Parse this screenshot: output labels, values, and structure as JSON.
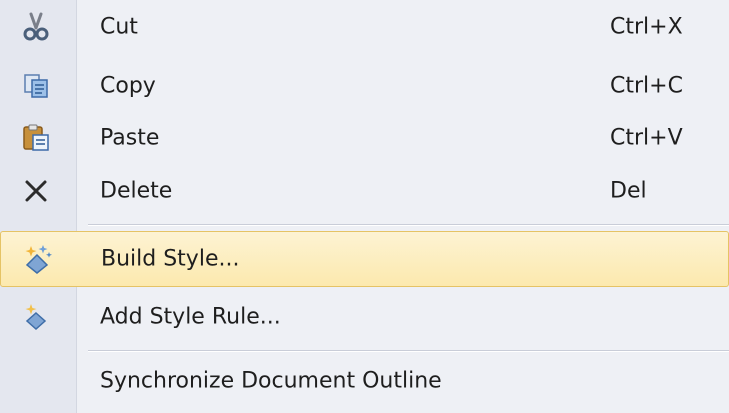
{
  "menu": {
    "items": [
      {
        "label": "Cut",
        "shortcut": "Ctrl+X",
        "icon": "scissors-icon"
      },
      {
        "label": "Copy",
        "shortcut": "Ctrl+C",
        "icon": "copy-icon"
      },
      {
        "label": "Paste",
        "shortcut": "Ctrl+V",
        "icon": "paste-icon"
      },
      {
        "label": "Delete",
        "shortcut": "Del",
        "icon": "delete-x-icon"
      },
      {
        "label": "Build Style...",
        "shortcut": "",
        "icon": "build-style-icon",
        "highlighted": true
      },
      {
        "label": "Add Style Rule...",
        "shortcut": "",
        "icon": "add-style-rule-icon"
      },
      {
        "label": "Synchronize Document Outline",
        "shortcut": "",
        "icon": ""
      }
    ]
  },
  "colors": {
    "highlight_fill": "#fce9ae",
    "highlight_border": "#e5c365",
    "gutter": "#e4e7ef",
    "menu_background": "#eef0f5"
  }
}
